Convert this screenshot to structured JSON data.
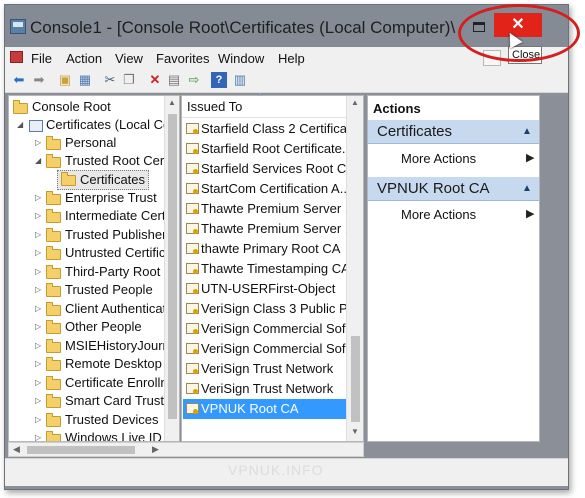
{
  "window": {
    "title": "Console1 - [Console Root\\Certificates (Local Computer)\\",
    "close_glyph": "✕",
    "close_tooltip": "Close"
  },
  "menu": [
    "File",
    "Action",
    "View",
    "Favorites",
    "Window",
    "Help"
  ],
  "tree": [
    {
      "label": "Console Root",
      "level": 0,
      "expander": "",
      "icon": "folder"
    },
    {
      "label": "Certificates (Local Co",
      "level": 1,
      "expander": "open",
      "icon": "certificates-snapin"
    },
    {
      "label": "Personal",
      "level": 2,
      "expander": "closed",
      "icon": "folder"
    },
    {
      "label": "Trusted Root Cert",
      "level": 2,
      "expander": "open",
      "icon": "folder"
    },
    {
      "label": "Certificates",
      "level": 3,
      "expander": "",
      "icon": "folder",
      "selected": true
    },
    {
      "label": "Enterprise Trust",
      "level": 2,
      "expander": "closed",
      "icon": "folder"
    },
    {
      "label": "Intermediate Cert",
      "level": 2,
      "expander": "closed",
      "icon": "folder"
    },
    {
      "label": "Trusted Publisher",
      "level": 2,
      "expander": "closed",
      "icon": "folder"
    },
    {
      "label": "Untrusted Certific",
      "level": 2,
      "expander": "closed",
      "icon": "folder"
    },
    {
      "label": "Third-Party Root",
      "level": 2,
      "expander": "closed",
      "icon": "folder"
    },
    {
      "label": "Trusted People",
      "level": 2,
      "expander": "closed",
      "icon": "folder"
    },
    {
      "label": "Client Authenticat",
      "level": 2,
      "expander": "closed",
      "icon": "folder"
    },
    {
      "label": "Other People",
      "level": 2,
      "expander": "closed",
      "icon": "folder"
    },
    {
      "label": "MSIEHistoryJourn",
      "level": 2,
      "expander": "closed",
      "icon": "folder"
    },
    {
      "label": "Remote Desktop",
      "level": 2,
      "expander": "closed",
      "icon": "folder"
    },
    {
      "label": "Certificate Enrolln",
      "level": 2,
      "expander": "closed",
      "icon": "folder"
    },
    {
      "label": "Smart Card Truste",
      "level": 2,
      "expander": "closed",
      "icon": "folder"
    },
    {
      "label": "Trusted Devices",
      "level": 2,
      "expander": "closed",
      "icon": "folder"
    },
    {
      "label": "Windows Live ID",
      "level": 2,
      "expander": "closed",
      "icon": "folder"
    }
  ],
  "list": {
    "column_header": "Issued To",
    "items": [
      "Starfield Class 2 Certifica...",
      "Starfield Root Certificate...",
      "Starfield Services Root C...",
      "StartCom Certification A...",
      "Thawte Premium Server ...",
      "Thawte Premium Server ...",
      "thawte Primary Root CA",
      "Thawte Timestamping CA",
      "UTN-USERFirst-Object",
      "VeriSign Class 3 Public Pr...",
      "VeriSign Commercial Sof...",
      "VeriSign Commercial Sof...",
      "VeriSign Trust Network",
      "VeriSign Trust Network",
      "VPNUK Root CA"
    ],
    "selected_item": "VPNUK Root CA"
  },
  "actions": {
    "header": "Actions",
    "sections": [
      {
        "title": "Certificates",
        "items": [
          "More Actions"
        ]
      },
      {
        "title": "VPNUK Root CA",
        "items": [
          "More Actions"
        ]
      }
    ]
  },
  "status": {
    "watermark": "VPNUK.INFO"
  },
  "colors": {
    "accent_selected": "#3399ff",
    "close_button": "#e2231a",
    "annotation_circle": "#d41f1f",
    "action_section_bg": "#c6d9ee"
  }
}
